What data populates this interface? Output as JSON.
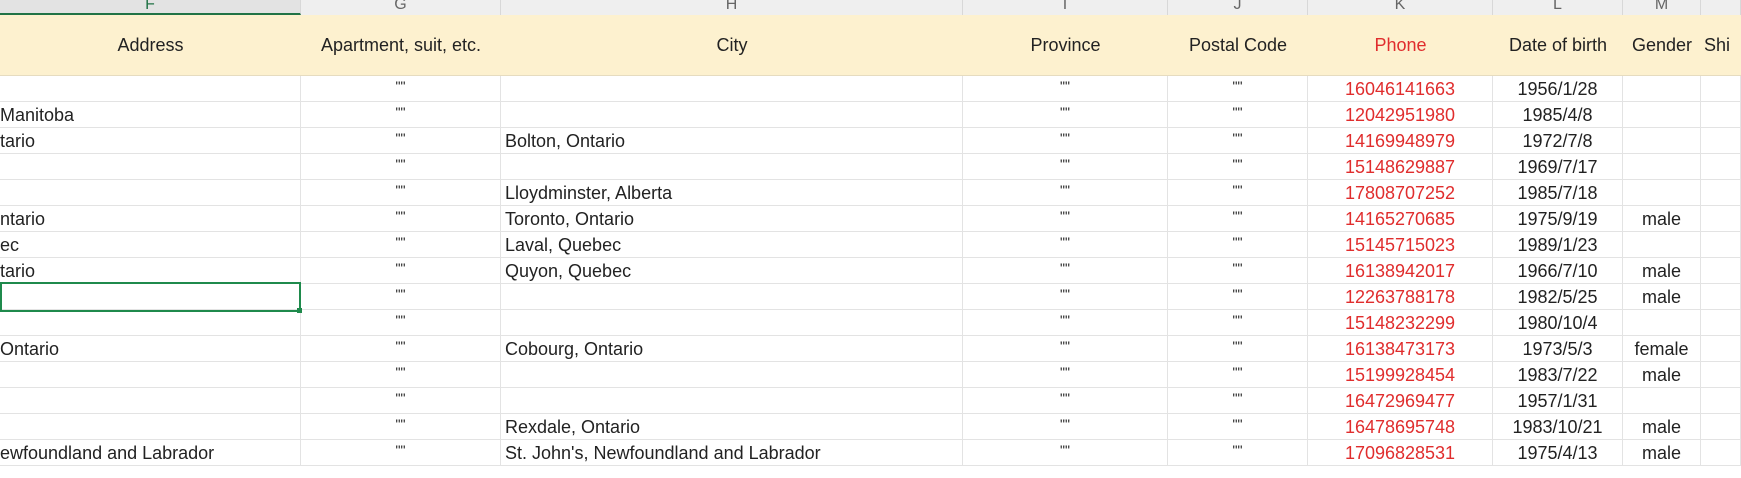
{
  "columns": [
    {
      "letter": "F",
      "header": "Address",
      "active": true
    },
    {
      "letter": "G",
      "header": "Apartment, suit, etc."
    },
    {
      "letter": "H",
      "header": "City"
    },
    {
      "letter": "I",
      "header": "Province"
    },
    {
      "letter": "J",
      "header": "Postal Code"
    },
    {
      "letter": "K",
      "header": "Phone"
    },
    {
      "letter": "L",
      "header": "Date of birth"
    },
    {
      "letter": "M",
      "header": "Gender"
    },
    {
      "letter": "",
      "header": "Shi"
    }
  ],
  "rows": [
    {
      "address": "",
      "apt": "\"\"",
      "city": "",
      "province": "\"\"",
      "postal": "\"\"",
      "phone": "16046141663",
      "dob": "1956/1/28",
      "gender": ""
    },
    {
      "address": "Manitoba",
      "apt": "\"\"",
      "city": "",
      "province": "\"\"",
      "postal": "\"\"",
      "phone": "12042951980",
      "dob": "1985/4/8",
      "gender": ""
    },
    {
      "address": "tario",
      "apt": "\"\"",
      "city": "Bolton, Ontario",
      "province": "\"\"",
      "postal": "\"\"",
      "phone": "14169948979",
      "dob": "1972/7/8",
      "gender": ""
    },
    {
      "address": "",
      "apt": "\"\"",
      "city": "",
      "province": "\"\"",
      "postal": "\"\"",
      "phone": "15148629887",
      "dob": "1969/7/17",
      "gender": ""
    },
    {
      "address": "",
      "apt": "\"\"",
      "city": "Lloydminster, Alberta",
      "province": "\"\"",
      "postal": "\"\"",
      "phone": "17808707252",
      "dob": "1985/7/18",
      "gender": ""
    },
    {
      "address": "ntario",
      "apt": "\"\"",
      "city": "Toronto, Ontario",
      "province": "\"\"",
      "postal": "\"\"",
      "phone": "14165270685",
      "dob": "1975/9/19",
      "gender": "male"
    },
    {
      "address": "ec",
      "apt": "\"\"",
      "city": "Laval, Quebec",
      "province": "\"\"",
      "postal": "\"\"",
      "phone": "15145715023",
      "dob": "1989/1/23",
      "gender": ""
    },
    {
      "address": "tario",
      "apt": "\"\"",
      "city": "Quyon, Quebec",
      "province": "\"\"",
      "postal": "\"\"",
      "phone": "16138942017",
      "dob": "1966/7/10",
      "gender": "male"
    },
    {
      "address": "",
      "apt": "\"\"",
      "city": "",
      "province": "\"\"",
      "postal": "\"\"",
      "phone": "12263788178",
      "dob": "1982/5/25",
      "gender": "male"
    },
    {
      "address": "",
      "apt": "\"\"",
      "city": "",
      "province": "\"\"",
      "postal": "\"\"",
      "phone": "15148232299",
      "dob": "1980/10/4",
      "gender": ""
    },
    {
      "address": "Ontario",
      "apt": "\"\"",
      "city": "Cobourg, Ontario",
      "province": "\"\"",
      "postal": "\"\"",
      "phone": "16138473173",
      "dob": "1973/5/3",
      "gender": "female"
    },
    {
      "address": "",
      "apt": "\"\"",
      "city": "",
      "province": "\"\"",
      "postal": "\"\"",
      "phone": "15199928454",
      "dob": "1983/7/22",
      "gender": "male"
    },
    {
      "address": "",
      "apt": "\"\"",
      "city": "",
      "province": "\"\"",
      "postal": "\"\"",
      "phone": "16472969477",
      "dob": "1957/1/31",
      "gender": ""
    },
    {
      "address": "",
      "apt": "\"\"",
      "city": "Rexdale, Ontario",
      "province": "\"\"",
      "postal": "\"\"",
      "phone": "16478695748",
      "dob": "1983/10/21",
      "gender": "male"
    },
    {
      "address": "ewfoundland and Labrador",
      "apt": "\"\"",
      "city": "St. John's, Newfoundland and Labrador",
      "province": "\"\"",
      "postal": "\"\"",
      "phone": "17096828531",
      "dob": "1975/4/13",
      "gender": "male"
    }
  ],
  "colors": {
    "header_bg": "#fdf1cf",
    "phone_text": "#e02d2d",
    "selection_border": "#1f8a4c"
  }
}
